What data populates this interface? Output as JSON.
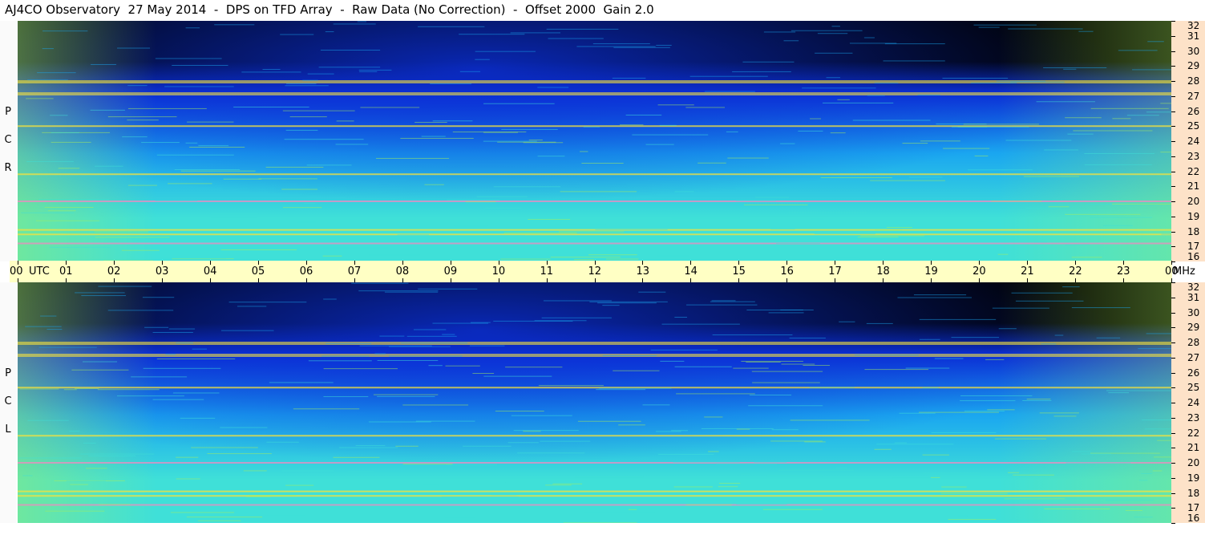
{
  "title": "AJ4CO Observatory  27 May 2014  -  DPS on TFD Array  -  Raw Data (No Correction)  -  Offset 2000  Gain 2.0",
  "chart_data": [
    {
      "type": "heatmap",
      "panel": "RCP",
      "side_label": [
        "R",
        "C",
        "P"
      ],
      "x_unit": "UTC",
      "x_ticks": [
        "00",
        "01",
        "02",
        "03",
        "04",
        "05",
        "06",
        "07",
        "08",
        "09",
        "10",
        "11",
        "12",
        "13",
        "14",
        "15",
        "16",
        "17",
        "18",
        "19",
        "20",
        "21",
        "22",
        "23",
        "00"
      ],
      "x_range_hours": [
        0,
        24
      ],
      "y_unit": "MHz",
      "y_range_mhz": [
        16,
        32
      ],
      "y_ticks": [
        16,
        17,
        18,
        19,
        20,
        21,
        22,
        23,
        24,
        25,
        26,
        27,
        28,
        29,
        30,
        31,
        32
      ],
      "colormap": [
        "#000000",
        "#0b2fd6",
        "#1aa6f0",
        "#3fe0d8",
        "#a8f05a",
        "#f6e23c",
        "#f08ac0"
      ],
      "strong_bands_mhz": [
        17.2,
        17.8,
        18.1,
        20.0,
        21.8,
        25.0,
        27.2,
        28.0
      ]
    },
    {
      "type": "heatmap",
      "panel": "LCP",
      "side_label": [
        "L",
        "C",
        "P"
      ],
      "x_unit": "UTC",
      "x_ticks": [
        "00",
        "01",
        "02",
        "03",
        "04",
        "05",
        "06",
        "07",
        "08",
        "09",
        "10",
        "11",
        "12",
        "13",
        "14",
        "15",
        "16",
        "17",
        "18",
        "19",
        "20",
        "21",
        "22",
        "23",
        "00"
      ],
      "x_range_hours": [
        0,
        24
      ],
      "y_unit": "MHz",
      "y_range_mhz": [
        16,
        32
      ],
      "y_ticks": [
        16,
        17,
        18,
        19,
        20,
        21,
        22,
        23,
        24,
        25,
        26,
        27,
        28,
        29,
        30,
        31,
        32
      ],
      "colormap": [
        "#000000",
        "#0b2fd6",
        "#1aa6f0",
        "#3fe0d8",
        "#a8f05a",
        "#f6e23c",
        "#f08ac0"
      ],
      "strong_bands_mhz": [
        17.2,
        17.8,
        18.1,
        20.0,
        21.8,
        25.0,
        27.2,
        28.0
      ]
    }
  ],
  "axis": {
    "utc_label": "UTC",
    "mhz_label": "MHz"
  }
}
